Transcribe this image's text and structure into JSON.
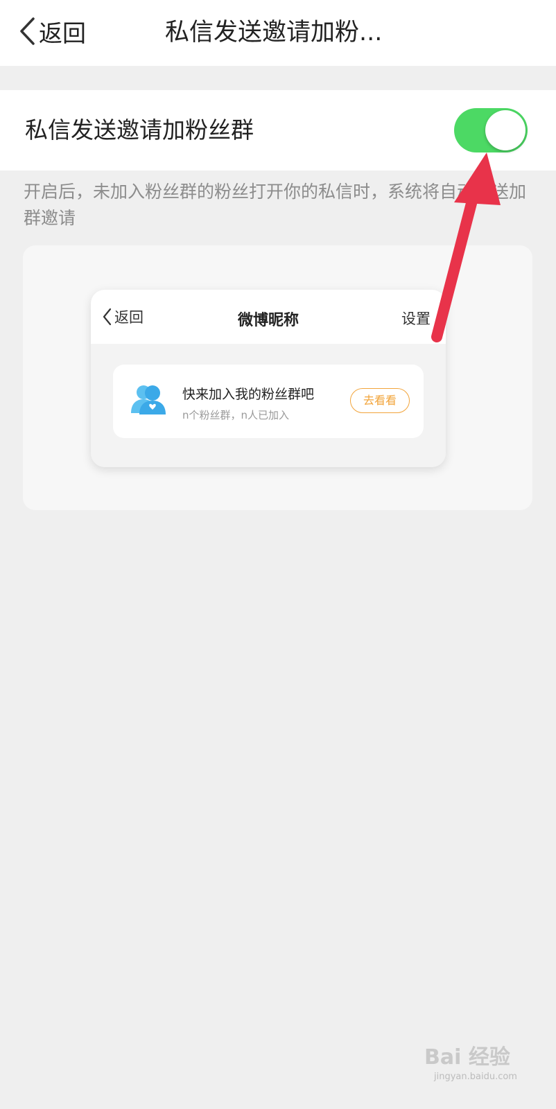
{
  "nav": {
    "back_label": "返回",
    "title": "私信发送邀请加粉..."
  },
  "setting": {
    "label": "私信发送邀请加粉丝群",
    "toggle_on": true,
    "toggle_color": "#4cd964"
  },
  "description": "开启后，未加入粉丝群的粉丝打开你的私信时，系统将自动发送加群邀请",
  "preview": {
    "back_label": "返回",
    "title": "微博昵称",
    "settings_label": "设置",
    "card": {
      "title": "快来加入我的粉丝群吧",
      "subtitle": "n个粉丝群，n人已加入",
      "button_label": "去看看",
      "button_color": "#f2a43a",
      "avatar_icon": "fans-group-icon",
      "avatar_color": "#3ba9e8"
    }
  },
  "annotation": {
    "arrow_color": "#e8334a"
  },
  "watermark": {
    "brand": "Bai 经验",
    "url": "jingyan.baidu.com"
  }
}
